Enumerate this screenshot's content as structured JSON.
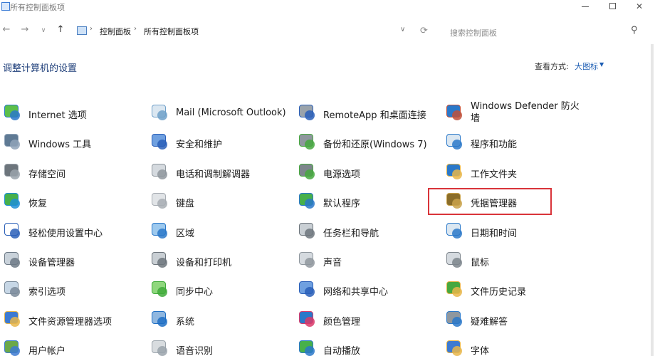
{
  "window": {
    "title": "所有控制面板项",
    "min_icon": "minimize-icon",
    "max_icon": "maximize-icon",
    "close_label": "✕"
  },
  "nav": {
    "breadcrumbs": [
      "控制面板",
      "所有控制面板项"
    ],
    "search_placeholder": "搜索控制面板"
  },
  "header": {
    "title": "调整计算机的设置",
    "view_by_label": "查看方式:",
    "view_by_value": "大图标"
  },
  "columns": [
    [
      {
        "label": "Internet 选项",
        "icon": "globe-network-icon",
        "colors": [
          "#2a78c9",
          "#5cbf4a"
        ]
      },
      {
        "label": "Windows 工具",
        "icon": "gears-icon",
        "colors": [
          "#8fa3b8",
          "#5f7a94"
        ]
      },
      {
        "label": "存储空间",
        "icon": "storage-drives-icon",
        "colors": [
          "#9aa3ab",
          "#6d757c"
        ]
      },
      {
        "label": "恢复",
        "icon": "recovery-monitor-icon",
        "colors": [
          "#1f8fd6",
          "#47b04b"
        ]
      },
      {
        "label": "轻松使用设置中心",
        "icon": "ease-of-access-icon",
        "colors": [
          "#2a5fb8",
          "#ffffff"
        ]
      },
      {
        "label": "设备管理器",
        "icon": "device-manager-icon",
        "colors": [
          "#6d7a86",
          "#c9d2da"
        ]
      },
      {
        "label": "索引选项",
        "icon": "magnifier-icon",
        "colors": [
          "#7a8a99",
          "#c7d7e6"
        ]
      },
      {
        "label": "文件资源管理器选项",
        "icon": "folder-options-icon",
        "colors": [
          "#e8b64a",
          "#3d7ad1"
        ]
      },
      {
        "label": "用户帐户",
        "icon": "user-accounts-icon",
        "colors": [
          "#3d7ad1",
          "#6ba84a"
        ]
      }
    ],
    [
      {
        "label": "Mail (Microsoft Outlook)",
        "icon": "mail-icon",
        "colors": [
          "#6fa0c9",
          "#dbe7f1"
        ]
      },
      {
        "label": "安全和维护",
        "icon": "flag-icon",
        "colors": [
          "#2a5fb8",
          "#6fa0e0"
        ]
      },
      {
        "label": "电话和调制解调器",
        "icon": "phone-modem-icon",
        "colors": [
          "#8f979e",
          "#d5dadf"
        ]
      },
      {
        "label": "键盘",
        "icon": "keyboard-icon",
        "colors": [
          "#a7adb3",
          "#e1e4e7"
        ]
      },
      {
        "label": "区域",
        "icon": "region-clock-icon",
        "colors": [
          "#2a78c9",
          "#9dc9ee"
        ]
      },
      {
        "label": "设备和打印机",
        "icon": "printer-icon",
        "colors": [
          "#6d757c",
          "#c9cfd4"
        ]
      },
      {
        "label": "同步中心",
        "icon": "sync-icon",
        "colors": [
          "#3faa3a",
          "#8fd77d"
        ]
      },
      {
        "label": "系统",
        "icon": "system-monitor-icon",
        "colors": [
          "#1f6fc4",
          "#8fb7e0"
        ]
      },
      {
        "label": "语音识别",
        "icon": "microphone-icon",
        "colors": [
          "#9aa3ab",
          "#d8dcdf"
        ]
      }
    ],
    [
      {
        "label": "RemoteApp 和桌面连接",
        "icon": "remote-desktop-icon",
        "colors": [
          "#2a5fb8",
          "#9aa3ab"
        ]
      },
      {
        "label": "备份和还原(Windows 7)",
        "icon": "backup-restore-icon",
        "colors": [
          "#47a83f",
          "#8f979e"
        ]
      },
      {
        "label": "电源选项",
        "icon": "power-battery-icon",
        "colors": [
          "#47a83f",
          "#7d858c"
        ]
      },
      {
        "label": "默认程序",
        "icon": "default-programs-icon",
        "colors": [
          "#2a78c9",
          "#47b04b"
        ]
      },
      {
        "label": "任务栏和导航",
        "icon": "taskbar-icon",
        "colors": [
          "#6d757c",
          "#c9cfd4"
        ]
      },
      {
        "label": "声音",
        "icon": "speaker-icon",
        "colors": [
          "#8f979e",
          "#d5dadf"
        ]
      },
      {
        "label": "网络和共享中心",
        "icon": "network-sharing-icon",
        "colors": [
          "#2a5fb8",
          "#6fa0e0"
        ]
      },
      {
        "label": "颜色管理",
        "icon": "color-management-icon",
        "colors": [
          "#d93a6a",
          "#2a78c9"
        ]
      },
      {
        "label": "自动播放",
        "icon": "autoplay-icon",
        "colors": [
          "#2a78c9",
          "#47b04b"
        ]
      }
    ],
    [
      {
        "label": "Windows Defender 防火墙",
        "icon": "firewall-icon",
        "colors": [
          "#c0503a",
          "#2a78c9"
        ]
      },
      {
        "label": "程序和功能",
        "icon": "programs-features-icon",
        "colors": [
          "#2a78c9",
          "#dbe7f1"
        ]
      },
      {
        "label": "工作文件夹",
        "icon": "work-folders-icon",
        "colors": [
          "#e8b64a",
          "#2a78c9"
        ]
      },
      {
        "label": "凭据管理器",
        "icon": "credential-vault-icon",
        "colors": [
          "#c9a24a",
          "#8a6d2a"
        ]
      },
      {
        "label": "日期和时间",
        "icon": "calendar-clock-icon",
        "colors": [
          "#2a78c9",
          "#dbe7f1"
        ]
      },
      {
        "label": "鼠标",
        "icon": "mouse-icon",
        "colors": [
          "#7d858c",
          "#d5dadf"
        ]
      },
      {
        "label": "文件历史记录",
        "icon": "file-history-icon",
        "colors": [
          "#e8b64a",
          "#47a83f"
        ]
      },
      {
        "label": "疑难解答",
        "icon": "troubleshooting-icon",
        "colors": [
          "#2a78c9",
          "#8f979e"
        ]
      },
      {
        "label": "字体",
        "icon": "fonts-icon",
        "colors": [
          "#e8b64a",
          "#3d7ad1"
        ]
      }
    ]
  ],
  "highlight": {
    "color": "#d9343a"
  }
}
